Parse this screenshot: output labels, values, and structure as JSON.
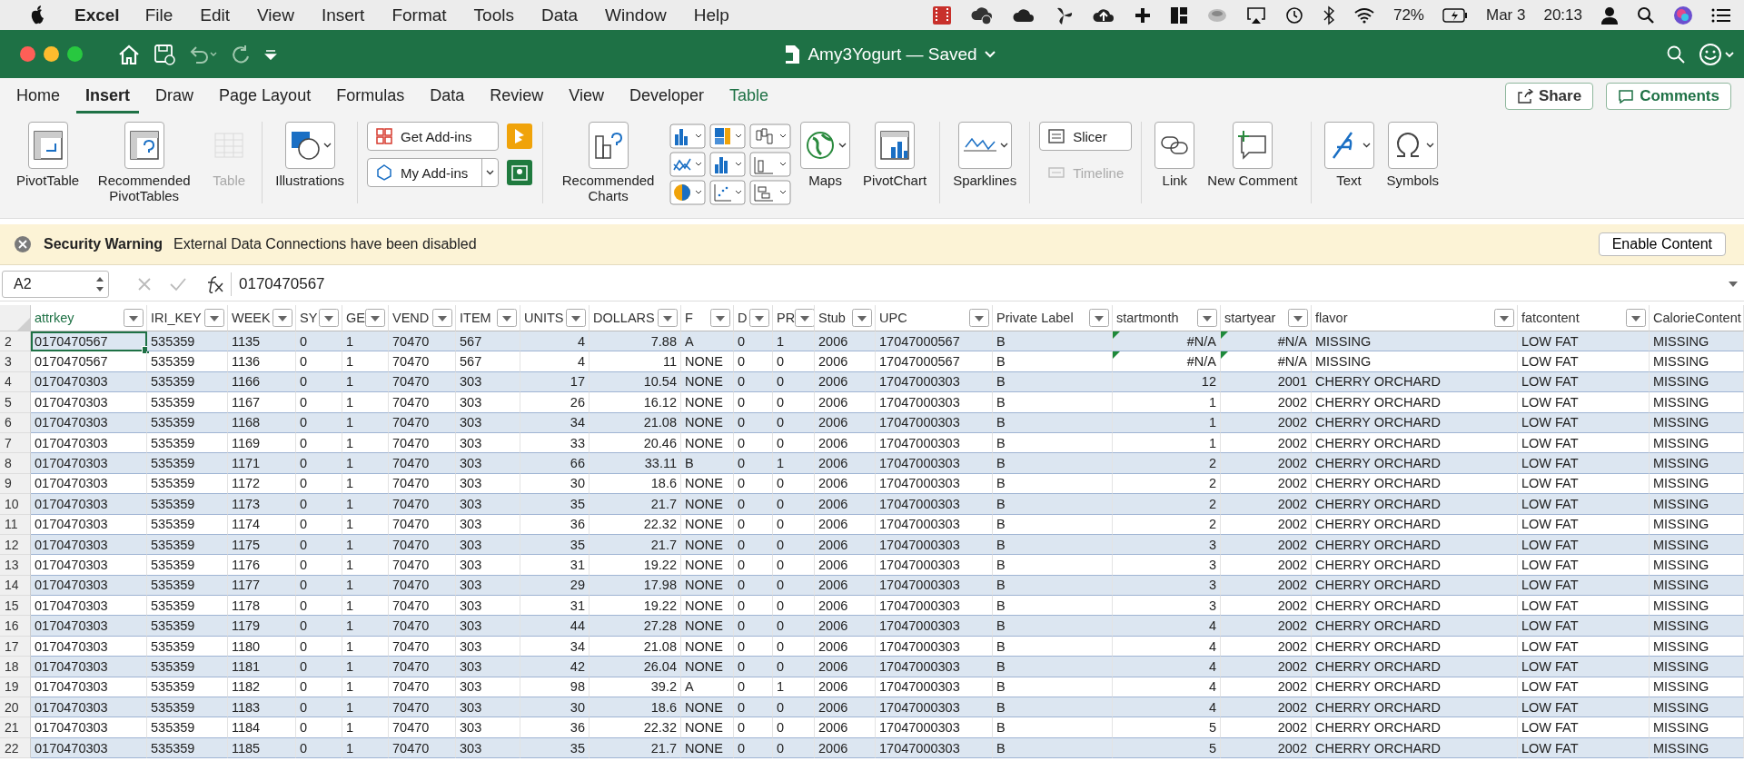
{
  "menu_bar": {
    "app": "Excel",
    "items": [
      "File",
      "Edit",
      "View",
      "Insert",
      "Format",
      "Tools",
      "Data",
      "Window",
      "Help"
    ],
    "battery": "72%",
    "date": "Mar 3",
    "time": "20:13"
  },
  "window": {
    "title": "Amy3Yogurt — Saved"
  },
  "tabs": [
    {
      "label": "Home",
      "selected": false,
      "kind": "standard"
    },
    {
      "label": "Insert",
      "selected": true,
      "kind": "standard"
    },
    {
      "label": "Draw",
      "selected": false,
      "kind": "standard"
    },
    {
      "label": "Page Layout",
      "selected": false,
      "kind": "standard"
    },
    {
      "label": "Formulas",
      "selected": false,
      "kind": "standard"
    },
    {
      "label": "Data",
      "selected": false,
      "kind": "standard"
    },
    {
      "label": "Review",
      "selected": false,
      "kind": "standard"
    },
    {
      "label": "View",
      "selected": false,
      "kind": "standard"
    },
    {
      "label": "Developer",
      "selected": false,
      "kind": "standard"
    },
    {
      "label": "Table",
      "selected": false,
      "kind": "contextual"
    }
  ],
  "share_button": "Share",
  "comments_button": "Comments",
  "ribbon": {
    "groups": [
      {
        "items": [
          {
            "kind": "large",
            "label": "PivotTable",
            "disabled": false,
            "dropdown": false
          },
          {
            "kind": "large",
            "label": "Recommended PivotTables",
            "disabled": false,
            "dropdown": false
          },
          {
            "kind": "large",
            "label": "Table",
            "disabled": true,
            "dropdown": false
          }
        ]
      },
      {
        "items": [
          {
            "kind": "large",
            "label": "Illustrations",
            "disabled": false,
            "dropdown": true
          }
        ]
      },
      {
        "items": [
          {
            "kind": "addin",
            "label": "Get Add-ins",
            "dropdown": false
          },
          {
            "kind": "addin",
            "label": "My Add-ins",
            "dropdown": true
          }
        ]
      },
      {
        "items": [
          {
            "kind": "large",
            "label": "Recommended Charts",
            "disabled": false,
            "dropdown": false
          },
          {
            "kind": "chart-grid"
          },
          {
            "kind": "large",
            "label": "Maps",
            "disabled": false,
            "dropdown": true
          },
          {
            "kind": "large",
            "label": "PivotChart",
            "disabled": false,
            "dropdown": false
          }
        ]
      },
      {
        "items": [
          {
            "kind": "large",
            "label": "Sparklines",
            "disabled": false,
            "dropdown": true
          }
        ]
      },
      {
        "items": [
          {
            "kind": "small",
            "label": "Slicer",
            "disabled": false
          },
          {
            "kind": "small",
            "label": "Timeline",
            "disabled": true
          }
        ]
      },
      {
        "items": [
          {
            "kind": "large",
            "label": "Link",
            "disabled": false,
            "dropdown": false
          },
          {
            "kind": "large",
            "label": "New Comment",
            "disabled": false,
            "dropdown": false
          }
        ]
      },
      {
        "items": [
          {
            "kind": "large",
            "label": "Text",
            "disabled": false,
            "dropdown": true
          },
          {
            "kind": "large",
            "label": "Symbols",
            "disabled": false,
            "dropdown": true
          }
        ]
      }
    ]
  },
  "security_bar": {
    "title": "Security Warning",
    "message": "External Data Connections have been disabled",
    "button": "Enable Content"
  },
  "formula_bar": {
    "name_box": "A2",
    "formula": "0170470567"
  },
  "table": {
    "columns": [
      {
        "label": "attrkey",
        "selected": true,
        "numeric": false
      },
      {
        "label": "IRI_KEY",
        "selected": false,
        "numeric": false
      },
      {
        "label": "WEEK",
        "selected": false,
        "numeric": false
      },
      {
        "label": "SY",
        "selected": false,
        "numeric": false
      },
      {
        "label": "GE",
        "selected": false,
        "numeric": false
      },
      {
        "label": "VEND",
        "selected": false,
        "numeric": false
      },
      {
        "label": "ITEM",
        "selected": false,
        "numeric": false
      },
      {
        "label": "UNITS",
        "selected": false,
        "numeric": true
      },
      {
        "label": "DOLLARS",
        "selected": false,
        "numeric": true
      },
      {
        "label": "F",
        "selected": false,
        "numeric": false
      },
      {
        "label": "D",
        "selected": false,
        "numeric": false
      },
      {
        "label": "PR",
        "selected": false,
        "numeric": false
      },
      {
        "label": "Stub",
        "selected": false,
        "numeric": false
      },
      {
        "label": "UPC",
        "selected": false,
        "numeric": false
      },
      {
        "label": "Private Label",
        "selected": false,
        "numeric": false
      },
      {
        "label": "startmonth",
        "selected": false,
        "numeric": true
      },
      {
        "label": "startyear",
        "selected": false,
        "numeric": true
      },
      {
        "label": "flavor",
        "selected": false,
        "numeric": false
      },
      {
        "label": "fatcontent",
        "selected": false,
        "numeric": false
      },
      {
        "label": "CalorieContent",
        "selected": false,
        "numeric": false
      }
    ],
    "rows": [
      {
        "number": "2",
        "selected": true,
        "cells": [
          "0170470567",
          "535359",
          "1135",
          "0",
          "1",
          "70470",
          "567",
          "4",
          "7.88",
          "A",
          "0",
          "1",
          "2006",
          "17047000567",
          "B",
          {
            "text": "#N/A",
            "error": true
          },
          {
            "text": "#N/A",
            "error": true
          },
          "MISSING",
          "LOW FAT",
          "MISSING"
        ]
      },
      {
        "number": "3",
        "selected": false,
        "cells": [
          "0170470567",
          "535359",
          "1136",
          "0",
          "1",
          "70470",
          "567",
          "4",
          "11",
          "NONE",
          "0",
          "0",
          "2006",
          "17047000567",
          "B",
          {
            "text": "#N/A",
            "error": true
          },
          {
            "text": "#N/A",
            "error": true
          },
          "MISSING",
          "LOW FAT",
          "MISSING"
        ]
      },
      {
        "number": "4",
        "selected": false,
        "cells": [
          "0170470303",
          "535359",
          "1166",
          "0",
          "1",
          "70470",
          "303",
          "17",
          "10.54",
          "NONE",
          "0",
          "0",
          "2006",
          "17047000303",
          "B",
          "12",
          "2001",
          "CHERRY ORCHARD",
          "LOW FAT",
          "MISSING"
        ]
      },
      {
        "number": "5",
        "selected": false,
        "cells": [
          "0170470303",
          "535359",
          "1167",
          "0",
          "1",
          "70470",
          "303",
          "26",
          "16.12",
          "NONE",
          "0",
          "0",
          "2006",
          "17047000303",
          "B",
          "1",
          "2002",
          "CHERRY ORCHARD",
          "LOW FAT",
          "MISSING"
        ]
      },
      {
        "number": "6",
        "selected": false,
        "cells": [
          "0170470303",
          "535359",
          "1168",
          "0",
          "1",
          "70470",
          "303",
          "34",
          "21.08",
          "NONE",
          "0",
          "0",
          "2006",
          "17047000303",
          "B",
          "1",
          "2002",
          "CHERRY ORCHARD",
          "LOW FAT",
          "MISSING"
        ]
      },
      {
        "number": "7",
        "selected": false,
        "cells": [
          "0170470303",
          "535359",
          "1169",
          "0",
          "1",
          "70470",
          "303",
          "33",
          "20.46",
          "NONE",
          "0",
          "0",
          "2006",
          "17047000303",
          "B",
          "1",
          "2002",
          "CHERRY ORCHARD",
          "LOW FAT",
          "MISSING"
        ]
      },
      {
        "number": "8",
        "selected": false,
        "cells": [
          "0170470303",
          "535359",
          "1171",
          "0",
          "1",
          "70470",
          "303",
          "66",
          "33.11",
          "B",
          "0",
          "1",
          "2006",
          "17047000303",
          "B",
          "2",
          "2002",
          "CHERRY ORCHARD",
          "LOW FAT",
          "MISSING"
        ]
      },
      {
        "number": "9",
        "selected": false,
        "cells": [
          "0170470303",
          "535359",
          "1172",
          "0",
          "1",
          "70470",
          "303",
          "30",
          "18.6",
          "NONE",
          "0",
          "0",
          "2006",
          "17047000303",
          "B",
          "2",
          "2002",
          "CHERRY ORCHARD",
          "LOW FAT",
          "MISSING"
        ]
      },
      {
        "number": "10",
        "selected": false,
        "cells": [
          "0170470303",
          "535359",
          "1173",
          "0",
          "1",
          "70470",
          "303",
          "35",
          "21.7",
          "NONE",
          "0",
          "0",
          "2006",
          "17047000303",
          "B",
          "2",
          "2002",
          "CHERRY ORCHARD",
          "LOW FAT",
          "MISSING"
        ]
      },
      {
        "number": "11",
        "selected": false,
        "cells": [
          "0170470303",
          "535359",
          "1174",
          "0",
          "1",
          "70470",
          "303",
          "36",
          "22.32",
          "NONE",
          "0",
          "0",
          "2006",
          "17047000303",
          "B",
          "2",
          "2002",
          "CHERRY ORCHARD",
          "LOW FAT",
          "MISSING"
        ]
      },
      {
        "number": "12",
        "selected": false,
        "cells": [
          "0170470303",
          "535359",
          "1175",
          "0",
          "1",
          "70470",
          "303",
          "35",
          "21.7",
          "NONE",
          "0",
          "0",
          "2006",
          "17047000303",
          "B",
          "3",
          "2002",
          "CHERRY ORCHARD",
          "LOW FAT",
          "MISSING"
        ]
      },
      {
        "number": "13",
        "selected": false,
        "cells": [
          "0170470303",
          "535359",
          "1176",
          "0",
          "1",
          "70470",
          "303",
          "31",
          "19.22",
          "NONE",
          "0",
          "0",
          "2006",
          "17047000303",
          "B",
          "3",
          "2002",
          "CHERRY ORCHARD",
          "LOW FAT",
          "MISSING"
        ]
      },
      {
        "number": "14",
        "selected": false,
        "cells": [
          "0170470303",
          "535359",
          "1177",
          "0",
          "1",
          "70470",
          "303",
          "29",
          "17.98",
          "NONE",
          "0",
          "0",
          "2006",
          "17047000303",
          "B",
          "3",
          "2002",
          "CHERRY ORCHARD",
          "LOW FAT",
          "MISSING"
        ]
      },
      {
        "number": "15",
        "selected": false,
        "cells": [
          "0170470303",
          "535359",
          "1178",
          "0",
          "1",
          "70470",
          "303",
          "31",
          "19.22",
          "NONE",
          "0",
          "0",
          "2006",
          "17047000303",
          "B",
          "3",
          "2002",
          "CHERRY ORCHARD",
          "LOW FAT",
          "MISSING"
        ]
      },
      {
        "number": "16",
        "selected": false,
        "cells": [
          "0170470303",
          "535359",
          "1179",
          "0",
          "1",
          "70470",
          "303",
          "44",
          "27.28",
          "NONE",
          "0",
          "0",
          "2006",
          "17047000303",
          "B",
          "4",
          "2002",
          "CHERRY ORCHARD",
          "LOW FAT",
          "MISSING"
        ]
      },
      {
        "number": "17",
        "selected": false,
        "cells": [
          "0170470303",
          "535359",
          "1180",
          "0",
          "1",
          "70470",
          "303",
          "34",
          "21.08",
          "NONE",
          "0",
          "0",
          "2006",
          "17047000303",
          "B",
          "4",
          "2002",
          "CHERRY ORCHARD",
          "LOW FAT",
          "MISSING"
        ]
      },
      {
        "number": "18",
        "selected": false,
        "cells": [
          "0170470303",
          "535359",
          "1181",
          "0",
          "1",
          "70470",
          "303",
          "42",
          "26.04",
          "NONE",
          "0",
          "0",
          "2006",
          "17047000303",
          "B",
          "4",
          "2002",
          "CHERRY ORCHARD",
          "LOW FAT",
          "MISSING"
        ]
      },
      {
        "number": "19",
        "selected": false,
        "cells": [
          "0170470303",
          "535359",
          "1182",
          "0",
          "1",
          "70470",
          "303",
          "98",
          "39.2",
          "A",
          "0",
          "1",
          "2006",
          "17047000303",
          "B",
          "4",
          "2002",
          "CHERRY ORCHARD",
          "LOW FAT",
          "MISSING"
        ]
      },
      {
        "number": "20",
        "selected": false,
        "cells": [
          "0170470303",
          "535359",
          "1183",
          "0",
          "1",
          "70470",
          "303",
          "30",
          "18.6",
          "NONE",
          "0",
          "0",
          "2006",
          "17047000303",
          "B",
          "4",
          "2002",
          "CHERRY ORCHARD",
          "LOW FAT",
          "MISSING"
        ]
      },
      {
        "number": "21",
        "selected": false,
        "cells": [
          "0170470303",
          "535359",
          "1184",
          "0",
          "1",
          "70470",
          "303",
          "36",
          "22.32",
          "NONE",
          "0",
          "0",
          "2006",
          "17047000303",
          "B",
          "5",
          "2002",
          "CHERRY ORCHARD",
          "LOW FAT",
          "MISSING"
        ]
      },
      {
        "number": "22",
        "selected": false,
        "cells": [
          "0170470303",
          "535359",
          "1185",
          "0",
          "1",
          "70470",
          "303",
          "35",
          "21.7",
          "NONE",
          "0",
          "0",
          "2006",
          "17047000303",
          "B",
          "5",
          "2002",
          "CHERRY ORCHARD",
          "LOW FAT",
          "MISSING"
        ]
      }
    ]
  }
}
